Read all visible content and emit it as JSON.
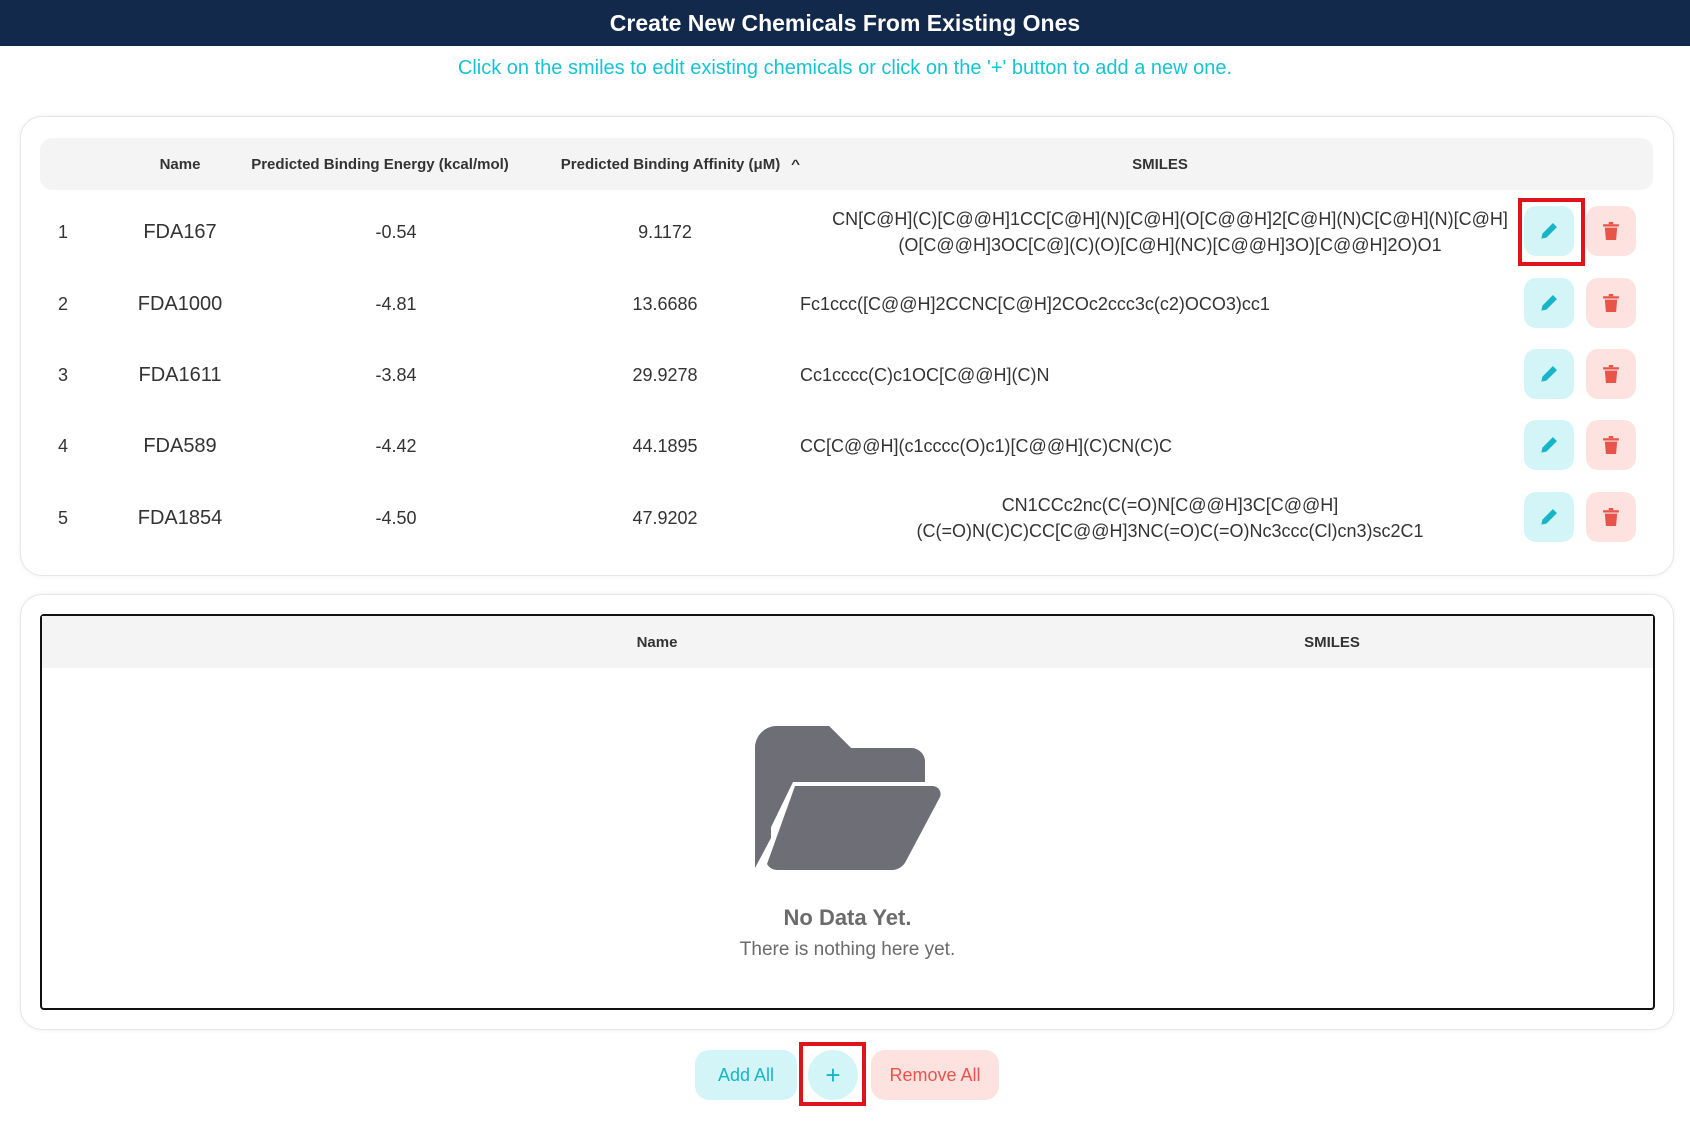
{
  "header": {
    "title": "Create New Chemicals From Existing Ones"
  },
  "subtitle": "Click on the smiles to edit existing chemicals or click on the '+' button to add a new one.",
  "table1": {
    "columns": {
      "name": "Name",
      "energy": "Predicted Binding Energy (kcal/mol)",
      "affinity": "Predicted Binding Affinity (μM)",
      "smiles": "SMILES"
    },
    "sort": {
      "column": "affinity",
      "direction": "ascending"
    },
    "rows": [
      {
        "index": "1",
        "name": "FDA167",
        "energy": "-0.54",
        "affinity": "9.1172",
        "smiles_line1": "CN[C@H](C)[C@@H]1CC[C@H](N)[C@H](O[C@@H]2[C@H](N)C[C@H](N)[C@H]",
        "smiles_line2": "(O[C@@H]3OC[C@](C)(O)[C@H](NC)[C@@H]3O)[C@@H]2O)O1"
      },
      {
        "index": "2",
        "name": "FDA1000",
        "energy": "-4.81",
        "affinity": "13.6686",
        "smiles_line1": "Fc1ccc([C@@H]2CCNC[C@H]2COc2ccc3c(c2)OCO3)cc1",
        "smiles_line2": ""
      },
      {
        "index": "3",
        "name": "FDA1611",
        "energy": "-3.84",
        "affinity": "29.9278",
        "smiles_line1": "Cc1cccc(C)c1OC[C@@H](C)N",
        "smiles_line2": ""
      },
      {
        "index": "4",
        "name": "FDA589",
        "energy": "-4.42",
        "affinity": "44.1895",
        "smiles_line1": "CC[C@@H](c1cccc(O)c1)[C@@H](C)CN(C)C",
        "smiles_line2": ""
      },
      {
        "index": "5",
        "name": "FDA1854",
        "energy": "-4.50",
        "affinity": "47.9202",
        "smiles_line1": "CN1CCc2nc(C(=O)N[C@@H]3C[C@@H]",
        "smiles_line2": "(C(=O)N(C)C)CC[C@@H]3NC(=O)C(=O)Nc3ccc(Cl)cn3)sc2C1"
      }
    ]
  },
  "table2": {
    "columns": {
      "name": "Name",
      "smiles": "SMILES"
    },
    "empty_title": "No Data Yet.",
    "empty_text": "There is nothing here yet."
  },
  "footer": {
    "add_all": "Add All",
    "plus": "+",
    "remove_all": "Remove All"
  },
  "icons": {
    "edit": "pencil-icon",
    "delete": "trash-icon",
    "empty": "folder-open-icon",
    "sort": "chevron-up-icon"
  },
  "colors": {
    "header_bg": "#13294b",
    "accent": "#17c3d3",
    "edit_bg": "#d4f5f8",
    "delete_bg": "#fde2e0",
    "delete_fg": "#e8544a",
    "highlight": "#e0121a"
  }
}
